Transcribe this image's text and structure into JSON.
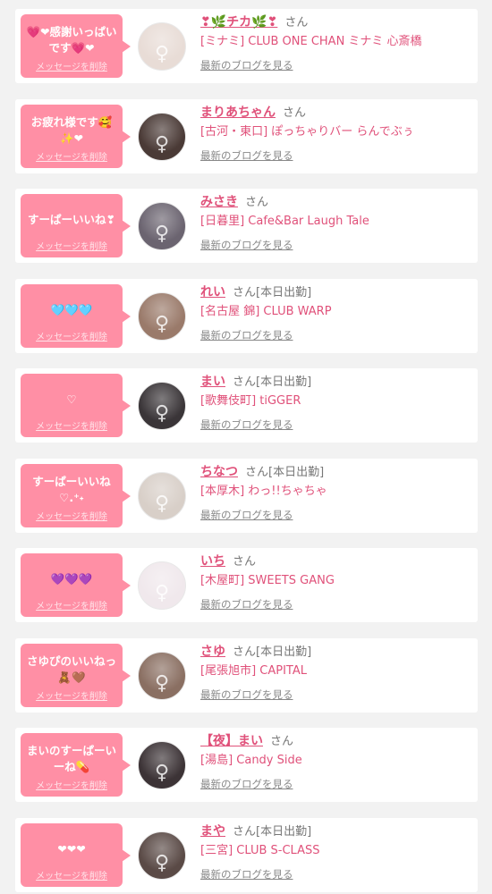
{
  "delete_label": "メッセージを削除",
  "blog_label": "最新のブログを見る",
  "honorific": "さん",
  "items": [
    {
      "message": "💗❤感謝いっぱい\nです💗❤",
      "name": "❣🌿チカ🌿❣",
      "status": "",
      "shop": "[ミナミ] CLUB ONE CHAN ミナミ 心斎橋",
      "avatar_color": "#e8dcd6",
      "avatar_glyph": "♀"
    },
    {
      "message": "お疲れ様です🥰\n✨❤",
      "name": "まりあちゃん",
      "status": "",
      "shop": "[古河・東口] ぽっちゃりバー らんでぶぅ",
      "avatar_color": "#4a3a36",
      "avatar_glyph": "♀"
    },
    {
      "message": "すーぱーいいね❣",
      "name": "みさき",
      "status": "",
      "shop": "[日暮里] Cafe&Bar Laugh Tale",
      "avatar_color": "#6b6470",
      "avatar_glyph": "♀"
    },
    {
      "message": "🩵🩵🩵",
      "name": "れい",
      "status": "[本日出勤]",
      "shop": "[名古屋 錦] CLUB WARP",
      "avatar_color": "#9a7a6a",
      "avatar_glyph": "♀"
    },
    {
      "message": "♡",
      "name": "まい",
      "status": "[本日出勤]",
      "shop": "[歌舞伎町] tiGGER",
      "avatar_color": "#3a3538",
      "avatar_glyph": "♀"
    },
    {
      "message": "すーぱーいいね\n♡.⁺˖",
      "name": "ちなつ",
      "status": "[本日出勤]",
      "shop": "[本厚木] わっ!!ちゃちゃ",
      "avatar_color": "#d8cfc8",
      "avatar_glyph": "♀"
    },
    {
      "message": "💜💜💜",
      "name": "いち",
      "status": "",
      "shop": "[木屋町] SWEETS GANG",
      "avatar_color": "#f0e8ec",
      "avatar_glyph": "♀"
    },
    {
      "message": "さゆぴのいいねっ\n🧸🤎",
      "name": "さゆ",
      "status": "[本日出勤]",
      "shop": "[尾張旭市] CAPITAL",
      "avatar_color": "#8a6f62",
      "avatar_glyph": "♀"
    },
    {
      "message": "まいのすーぱーい\nーね💊",
      "name": "【夜】まい",
      "status": "",
      "shop": "[湯島] Candy Side",
      "avatar_color": "#3c3336",
      "avatar_glyph": "♀"
    },
    {
      "message": "❤❤❤",
      "name": "まや",
      "status": "[本日出勤]",
      "shop": "[三宮] CLUB S-CLASS",
      "avatar_color": "#5a4a46",
      "avatar_glyph": "♀"
    }
  ]
}
